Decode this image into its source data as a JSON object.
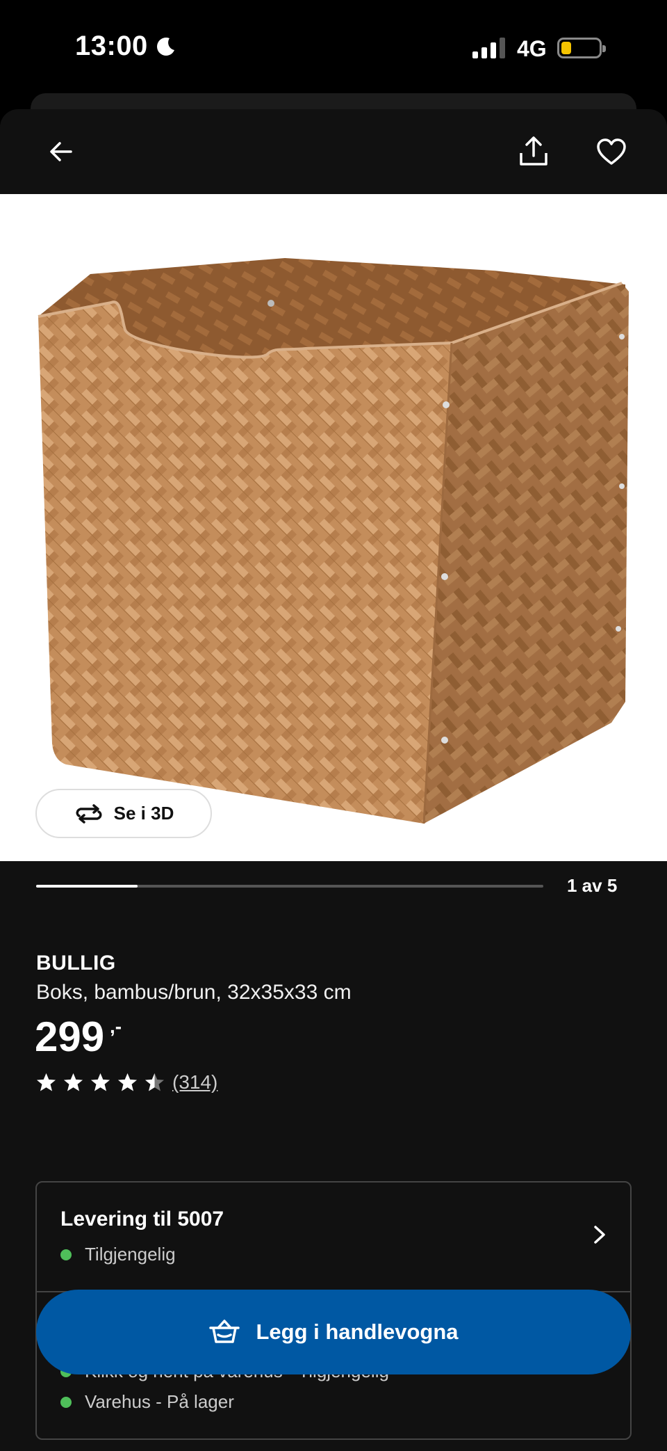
{
  "status_bar": {
    "time": "13:00",
    "network": "4G"
  },
  "nav": {
    "back_icon": "arrow-left-icon",
    "share_icon": "share-icon",
    "favorite_icon": "heart-icon"
  },
  "gallery": {
    "view_3d_label": "Se i 3D",
    "counter": "1 av 5",
    "current_image": 1,
    "total_images": 5
  },
  "product": {
    "name": "BULLIG",
    "description": "Boks, bambus/brun, 32x35x33 cm",
    "price": "299",
    "price_suffix": ",-",
    "rating": 4.5,
    "rating_max": 5,
    "review_count": "(314)"
  },
  "delivery": {
    "title": "Levering til 5007",
    "status": "Tilgjengelig",
    "pickup": "Klikk og hent på varehus - Tilgjengelig",
    "store": "Varehus - På lager",
    "status_color": "#4fbf5a"
  },
  "cta": {
    "label": "Legg i handlevogna",
    "color": "#0058a3"
  }
}
